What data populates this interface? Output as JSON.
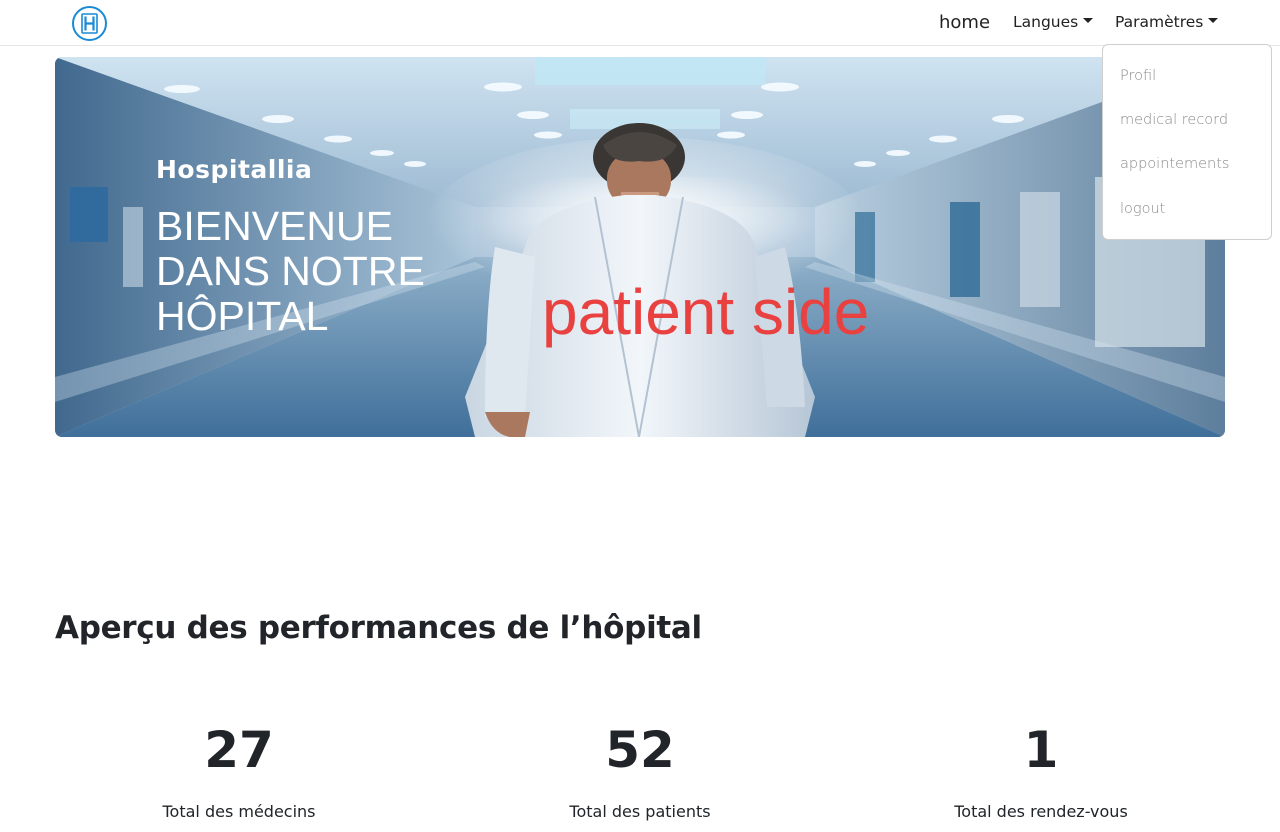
{
  "navbar": {
    "logo_icon": "hospital-h-icon",
    "home": "home",
    "langues": "Langues",
    "parametres": "Paramètres"
  },
  "dropdown": {
    "items": [
      "Profil",
      "medical record",
      "appointements",
      "logout"
    ]
  },
  "hero": {
    "brand": "Hospitallia",
    "title": "BIENVENUE DANS NOTRE HÔPITAL",
    "tag": "patient side",
    "tag_color": "#e8413f"
  },
  "stats": {
    "title": "Aperçu des performances de l’hôpital",
    "items": [
      {
        "value": "27",
        "label": "Total des médecins"
      },
      {
        "value": "52",
        "label": "Total des patients"
      },
      {
        "value": "1",
        "label": "Total des rendez-vous"
      }
    ]
  },
  "colors": {
    "logo_blue": "#1a8ad4",
    "text_dark": "#212529",
    "dropdown_text": "#8a8a8a"
  }
}
